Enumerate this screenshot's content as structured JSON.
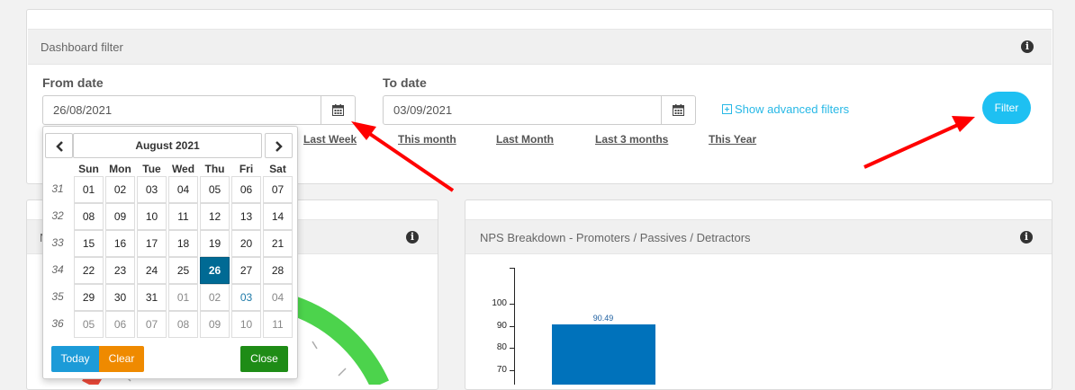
{
  "filter": {
    "title": "Dashboard filter",
    "from_label": "From date",
    "from_value": "26/08/2021",
    "to_label": "To date",
    "to_value": "03/09/2021",
    "quick_links": [
      "Last Week",
      "This month",
      "Last Month",
      "Last 3 months",
      "This Year"
    ],
    "advanced_label": "Show advanced filters",
    "button_label": "Filter"
  },
  "left_panel": {
    "title_fragment": "N"
  },
  "right_panel": {
    "title": "NPS Breakdown - Promoters / Passives / Detractors"
  },
  "datepicker": {
    "month": "August 2021",
    "weekdays": [
      "Sun",
      "Mon",
      "Tue",
      "Wed",
      "Thu",
      "Fri",
      "Sat"
    ],
    "weeks": [
      {
        "num": "31",
        "days": [
          "01",
          "02",
          "03",
          "04",
          "05",
          "06",
          "07"
        ]
      },
      {
        "num": "32",
        "days": [
          "08",
          "09",
          "10",
          "11",
          "12",
          "13",
          "14"
        ]
      },
      {
        "num": "33",
        "days": [
          "15",
          "16",
          "17",
          "18",
          "19",
          "20",
          "21"
        ]
      },
      {
        "num": "34",
        "days": [
          "22",
          "23",
          "24",
          "25",
          "26",
          "27",
          "28"
        ]
      },
      {
        "num": "35",
        "days": [
          "29",
          "30",
          "31",
          "01",
          "02",
          "03",
          "04"
        ]
      },
      {
        "num": "36",
        "days": [
          "05",
          "06",
          "07",
          "08",
          "09",
          "10",
          "11"
        ]
      }
    ],
    "selected": "26",
    "today_label": "Today",
    "clear_label": "Clear",
    "close_label": "Close"
  },
  "chart_data": {
    "type": "bar",
    "title": "NPS Breakdown - Promoters / Passives / Detractors",
    "y_ticks": [
      100,
      90,
      80,
      70
    ],
    "values": [
      90.49
    ],
    "data_labels": [
      "90.49"
    ],
    "colors": [
      "#0072bb"
    ]
  },
  "colors": {
    "accent": "#1ec0f2",
    "selected_day": "#006a94",
    "today_button": "#1c9bd8",
    "clear_button": "#ef8a00",
    "close_button": "#1e8c16",
    "gauge_green": "#4cd34c",
    "arrow": "#ff0000"
  }
}
